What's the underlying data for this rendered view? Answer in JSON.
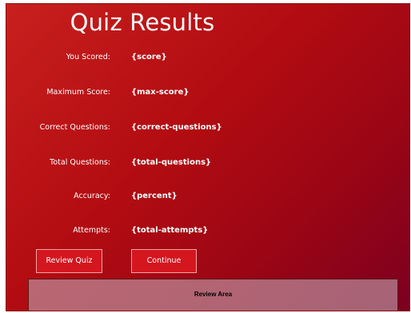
{
  "title": "Quiz Results",
  "stats": [
    {
      "label": "You Scored:",
      "value": "{score}"
    },
    {
      "label": "Maximum Score:",
      "value": "{max-score}"
    },
    {
      "label": "Correct Questions:",
      "value": "{correct-questions}"
    },
    {
      "label": "Total Questions:",
      "value": "{total-questions}"
    },
    {
      "label": "Accuracy:",
      "value": "{percent}"
    },
    {
      "label": "Attempts:",
      "value": "{total-attempts}"
    }
  ],
  "buttons": {
    "review_label": "Review Quiz",
    "continue_label": "Continue"
  },
  "review_area": {
    "label": "Review Area"
  },
  "colors": {
    "background_start": "#c8201e",
    "background_end": "#7c0020",
    "button": "#d4161f",
    "button_border": "#f4a3a3",
    "text": "#ffffff"
  }
}
